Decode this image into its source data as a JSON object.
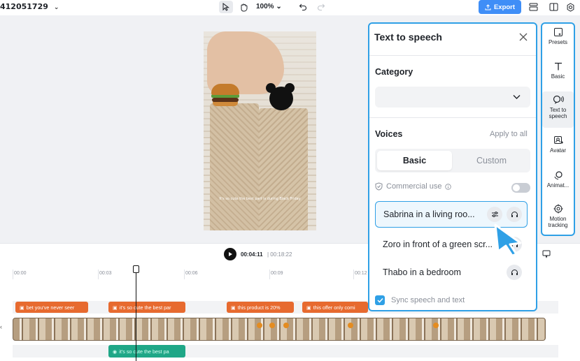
{
  "topbar": {
    "project_name": "412051729",
    "zoom": "100%",
    "export_label": "Export"
  },
  "preview": {
    "subtitle": "It's so cute the best part is during Black Friday"
  },
  "player": {
    "current_time": "00:04:11",
    "total_time": "| 00:18:22"
  },
  "timeline": {
    "ticks": [
      "00:00",
      "00:03",
      "00:06",
      "00:09",
      "00:12"
    ],
    "captions": [
      "bet you've never seer",
      "it's so cute the best par",
      "this product is 20%",
      "this offer only comi"
    ],
    "audio_clip": "it's so cute the best pa"
  },
  "tts_panel": {
    "title": "Text to speech",
    "category_label": "Category",
    "category_value": "",
    "voices_label": "Voices",
    "apply_all": "Apply to all",
    "tabs": [
      "Basic",
      "Custom"
    ],
    "active_tab": "Basic",
    "commercial_use": "Commercial use",
    "commercial_enabled": false,
    "voices": [
      {
        "name": "Sabrina in a living roo...",
        "selected": true
      },
      {
        "name": "Zoro in front of a green scr...",
        "selected": false
      },
      {
        "name": "Thabo in a bedroom",
        "selected": false
      }
    ],
    "sync_label": "Sync speech and text",
    "sync_checked": true
  },
  "rail": {
    "items": [
      {
        "label": "Presets",
        "icon": "presets-icon"
      },
      {
        "label": "Basic",
        "icon": "text-icon"
      },
      {
        "label": "Text to speech",
        "icon": "speech-icon",
        "active": true
      },
      {
        "label": "Avatar",
        "icon": "avatar-icon"
      },
      {
        "label": "Animat...",
        "icon": "animation-icon"
      },
      {
        "label": "Motion tracking",
        "icon": "motion-tracking-icon"
      }
    ]
  },
  "colors": {
    "accent": "#2fa0e6",
    "export": "#3f8ef7",
    "caption": "#e76a2f",
    "audio": "#1fa787"
  }
}
